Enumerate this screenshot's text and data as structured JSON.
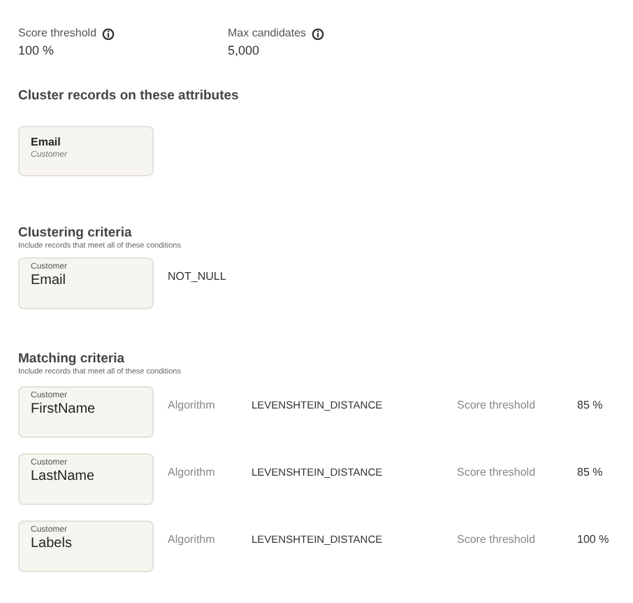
{
  "settings": [
    {
      "label": "Score threshold",
      "value": "100 %",
      "has_info": true
    },
    {
      "label": "Max candidates",
      "value": "5,000",
      "has_info": true
    }
  ],
  "cluster_attributes": {
    "heading": "Cluster records on these attributes",
    "items": [
      {
        "name": "Email",
        "entity": "Customer"
      }
    ]
  },
  "clustering_criteria": {
    "heading": "Clustering criteria",
    "subtitle": "Include records that meet all of these conditions",
    "rows": [
      {
        "entity": "Customer",
        "attribute": "Email",
        "condition": "NOT_NULL"
      }
    ]
  },
  "matching_criteria": {
    "heading": "Matching criteria",
    "subtitle": "Include records that meet all of these conditions",
    "rows": [
      {
        "entity": "Customer",
        "attribute": "FirstName",
        "algorithm_label": "Algorithm",
        "algorithm": "LEVENSHTEIN_DISTANCE",
        "threshold_label": "Score threshold",
        "threshold": "85 %"
      },
      {
        "entity": "Customer",
        "attribute": "LastName",
        "algorithm_label": "Algorithm",
        "algorithm": "LEVENSHTEIN_DISTANCE",
        "threshold_label": "Score threshold",
        "threshold": "85 %"
      },
      {
        "entity": "Customer",
        "attribute": "Labels",
        "algorithm_label": "Algorithm",
        "algorithm": "LEVENSHTEIN_DISTANCE",
        "threshold_label": "Score threshold",
        "threshold": "100 %"
      }
    ]
  }
}
